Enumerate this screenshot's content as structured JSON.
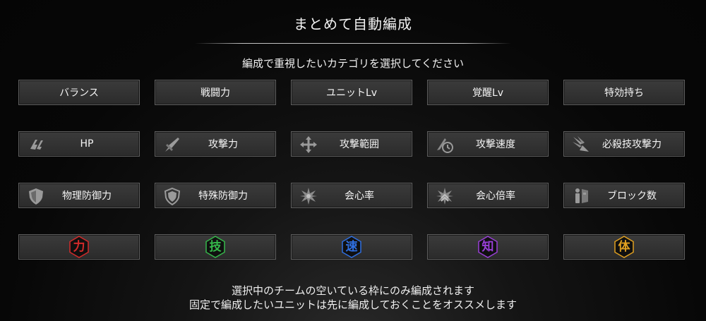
{
  "title": "まとめて自動編成",
  "instruction": "編成で重視したいカテゴリを選択してください",
  "rows": [
    [
      {
        "label": "バランス"
      },
      {
        "label": "戦闘力"
      },
      {
        "label": "ユニットLv"
      },
      {
        "label": "覚醒Lv"
      },
      {
        "label": "特効持ち"
      }
    ],
    [
      {
        "label": "HP",
        "icon": "hp-icon"
      },
      {
        "label": "攻撃力",
        "icon": "attack-icon"
      },
      {
        "label": "攻撃範囲",
        "icon": "attack-range-icon"
      },
      {
        "label": "攻撃速度",
        "icon": "attack-speed-icon"
      },
      {
        "label": "必殺技攻撃力",
        "icon": "special-attack-icon"
      }
    ],
    [
      {
        "label": "物理防御力",
        "icon": "physical-defense-icon"
      },
      {
        "label": "特殊防御力",
        "icon": "special-defense-icon"
      },
      {
        "label": "会心率",
        "icon": "critical-rate-icon"
      },
      {
        "label": "会心倍率",
        "icon": "critical-multiplier-icon"
      },
      {
        "label": "ブロック数",
        "icon": "block-count-icon"
      }
    ]
  ],
  "attributes": [
    {
      "char": "力",
      "color": "#d42a2a",
      "icon": "power-attribute-icon"
    },
    {
      "char": "技",
      "color": "#35b84a",
      "icon": "technique-attribute-icon"
    },
    {
      "char": "速",
      "color": "#2f6fe0",
      "icon": "speed-attribute-icon"
    },
    {
      "char": "知",
      "color": "#9a3fd8",
      "icon": "intelligence-attribute-icon"
    },
    {
      "char": "体",
      "color": "#e0a020",
      "icon": "stamina-attribute-icon"
    }
  ],
  "notes": [
    "選択中のチームの空いている枠にのみ編成されます",
    "固定で編成したいユニットは先に編成しておくことをオススメします"
  ]
}
